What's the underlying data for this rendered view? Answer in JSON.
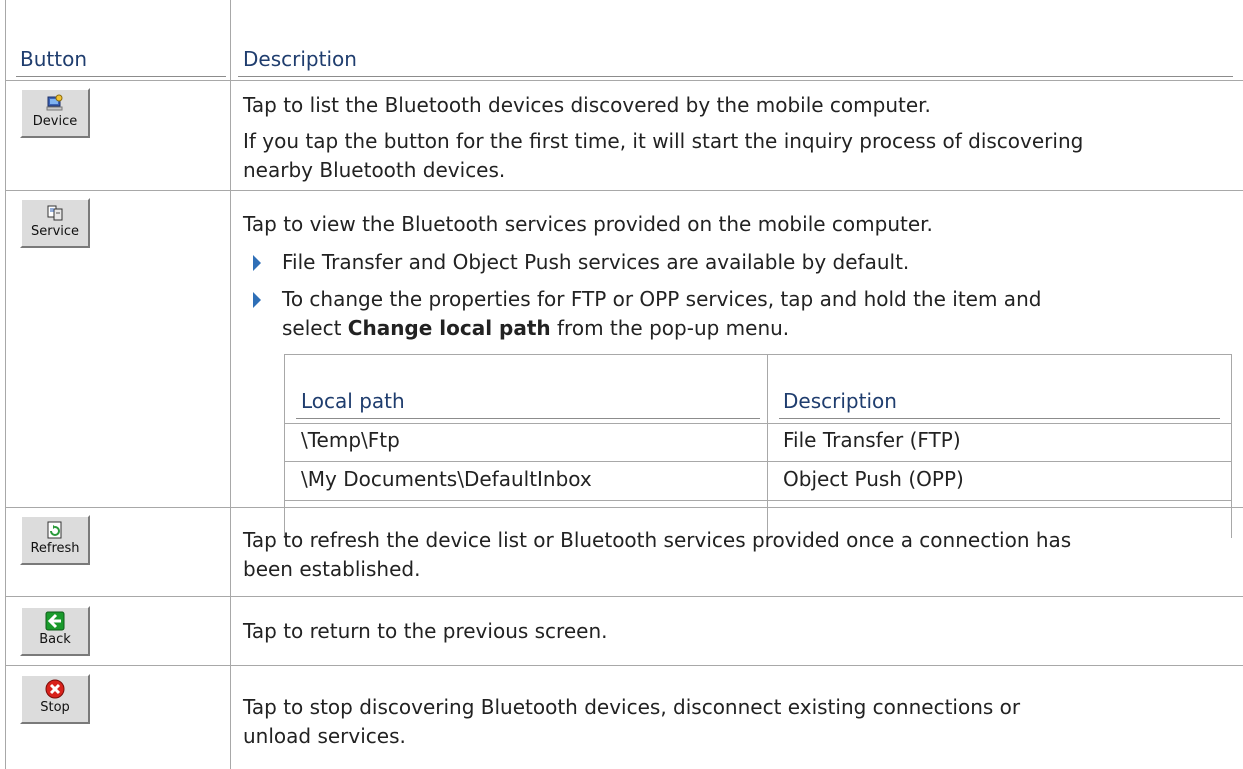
{
  "headers": {
    "button": "Button",
    "description": "Description"
  },
  "rows": {
    "device": {
      "button_label": "Device",
      "icon": "computer-icon",
      "desc": [
        "Tap to list the Bluetooth devices discovered by the mobile computer.",
        "If you tap the button for the first time, it will start the inquiry process of discovering",
        "nearby Bluetooth devices."
      ]
    },
    "service": {
      "button_label": "Service",
      "icon": "service-icon",
      "desc": "Tap to view the Bluetooth services provided on the mobile computer.",
      "bullet1": "File Transfer and Object Push services are available by default.",
      "bullet2_line1": "To change the properties for FTP or OPP services, tap and hold the item and",
      "bullet2_pre": "select ",
      "bullet2_bold": "Change local path",
      "bullet2_post": " from the pop-up menu.",
      "table": {
        "headers": [
          "Local path",
          "Description"
        ],
        "rows": [
          [
            "\\Temp\\Ftp",
            "File Transfer (FTP)"
          ],
          [
            "\\My Documents\\DefaultInbox",
            "Object Push (OPP)"
          ]
        ]
      }
    },
    "refresh": {
      "button_label": "Refresh",
      "icon": "refresh-icon",
      "desc": [
        "Tap to refresh the device list or Bluetooth services provided once a connection has",
        "been established."
      ]
    },
    "back": {
      "button_label": "Back",
      "icon": "back-arrow-icon",
      "desc": "Tap to return to the previous screen."
    },
    "stop": {
      "button_label": "Stop",
      "icon": "stop-icon",
      "desc": [
        "Tap to stop discovering Bluetooth devices, disconnect existing connections or",
        "unload services."
      ]
    }
  },
  "colors": {
    "header_text": "#1f3d6e",
    "bullet": "#2f6fb7",
    "stop_red": "#d8221c",
    "back_green": "#1a9a2c"
  }
}
